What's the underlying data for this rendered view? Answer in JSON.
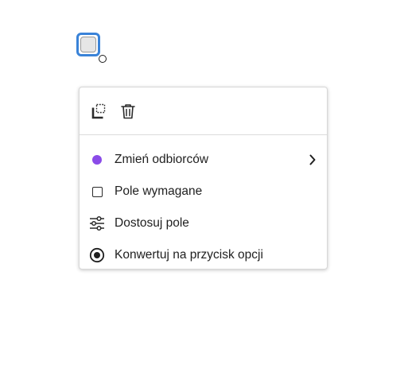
{
  "form_field": {
    "type": "checkbox",
    "state": "selected"
  },
  "toolbar": {
    "duplicate_icon": "duplicate-icon",
    "delete_icon": "trash-icon"
  },
  "menu": {
    "items": [
      {
        "label": "Zmień odbiorców",
        "icon": "recipient-color-dot-icon",
        "has_submenu": true
      },
      {
        "label": "Pole wymagane",
        "icon": "checkbox-empty-icon",
        "has_submenu": false
      },
      {
        "label": "Dostosuj pole",
        "icon": "sliders-icon",
        "has_submenu": false
      },
      {
        "label": "Konwertuj na przycisk opcji",
        "icon": "radio-button-icon",
        "has_submenu": false
      }
    ]
  },
  "colors": {
    "selection_border": "#3a83d8",
    "recipient_dot": "#8a4be8",
    "text": "#1f1f1f"
  }
}
